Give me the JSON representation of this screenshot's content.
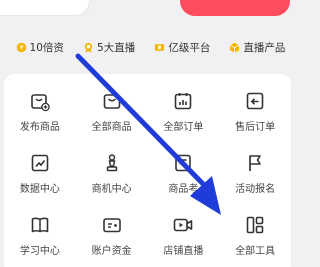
{
  "perks": [
    {
      "icon": "coin-icon",
      "label": "10倍资"
    },
    {
      "icon": "medal-icon",
      "label": "5大直播"
    },
    {
      "icon": "ticket-icon",
      "label": "亿级平台"
    },
    {
      "icon": "box-icon",
      "label": "直播产品"
    }
  ],
  "tools": [
    {
      "name": "publish-product",
      "icon": "bag-plus-icon",
      "label": "发布商品"
    },
    {
      "name": "all-products",
      "icon": "bag-icon",
      "label": "全部商品"
    },
    {
      "name": "all-orders",
      "icon": "calendar-chart-icon",
      "label": "全部订单"
    },
    {
      "name": "after-sale-orders",
      "icon": "return-icon",
      "label": "售后订单"
    },
    {
      "name": "data-center",
      "icon": "trend-chart-icon",
      "label": "数据中心"
    },
    {
      "name": "merchant-center",
      "icon": "chess-pawn-icon",
      "label": "商机中心"
    },
    {
      "name": "product-review",
      "icon": "doc-icon",
      "label": "商品考"
    },
    {
      "name": "event-signup",
      "icon": "flag-icon",
      "label": "活动报名"
    },
    {
      "name": "learning-center",
      "icon": "book-icon",
      "label": "学习中心"
    },
    {
      "name": "account-funds",
      "icon": "wallet-icon",
      "label": "账户资金"
    },
    {
      "name": "shop-live",
      "icon": "video-icon",
      "label": "店铺直播"
    },
    {
      "name": "all-tools",
      "icon": "apps-icon",
      "label": "全部工具"
    }
  ],
  "colors": {
    "accent": "#f5b400",
    "arrow": "#1f3bd8",
    "icon": "#333333"
  }
}
